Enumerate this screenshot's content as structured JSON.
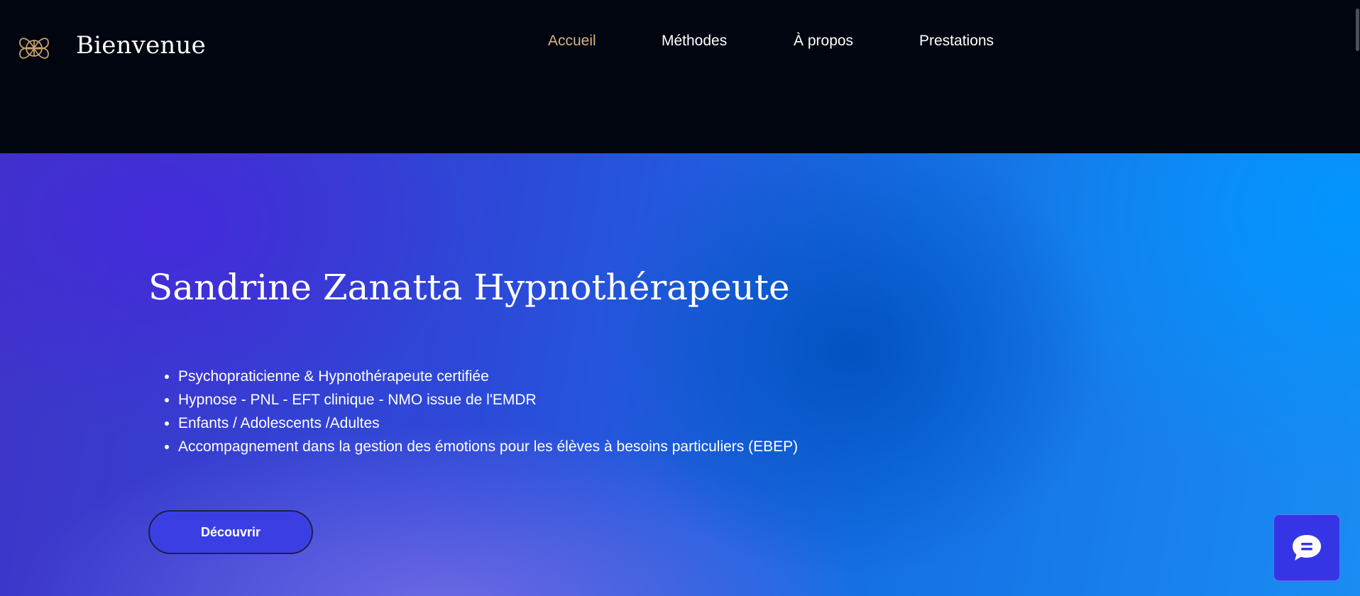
{
  "header": {
    "brand": "Bienvenue",
    "logo_icon": "celtic-knot-logo-icon",
    "accent_color": "#d7b187"
  },
  "nav": {
    "items": [
      {
        "label": "Accueil",
        "active": true
      },
      {
        "label": "Méthodes",
        "active": false
      },
      {
        "label": "À propos",
        "active": false
      },
      {
        "label": "Prestations",
        "active": false
      }
    ]
  },
  "hero": {
    "title": "Sandrine Zanatta Hypnothérapeute",
    "bullets": [
      "Psychopraticienne & Hypnothérapeute certifiée",
      "Hypnose - PNL - EFT clinique - NMO issue de l'EMDR",
      "Enfants / Adolescents /Adultes",
      "Accompagnement dans la gestion des émotions pour les élèves à besoins particuliers (EBEP)"
    ],
    "cta_label": "Découvrir",
    "cta_color": "#3b3fe3"
  },
  "chat": {
    "icon": "chat-bubble-icon",
    "color": "#3535e6"
  }
}
